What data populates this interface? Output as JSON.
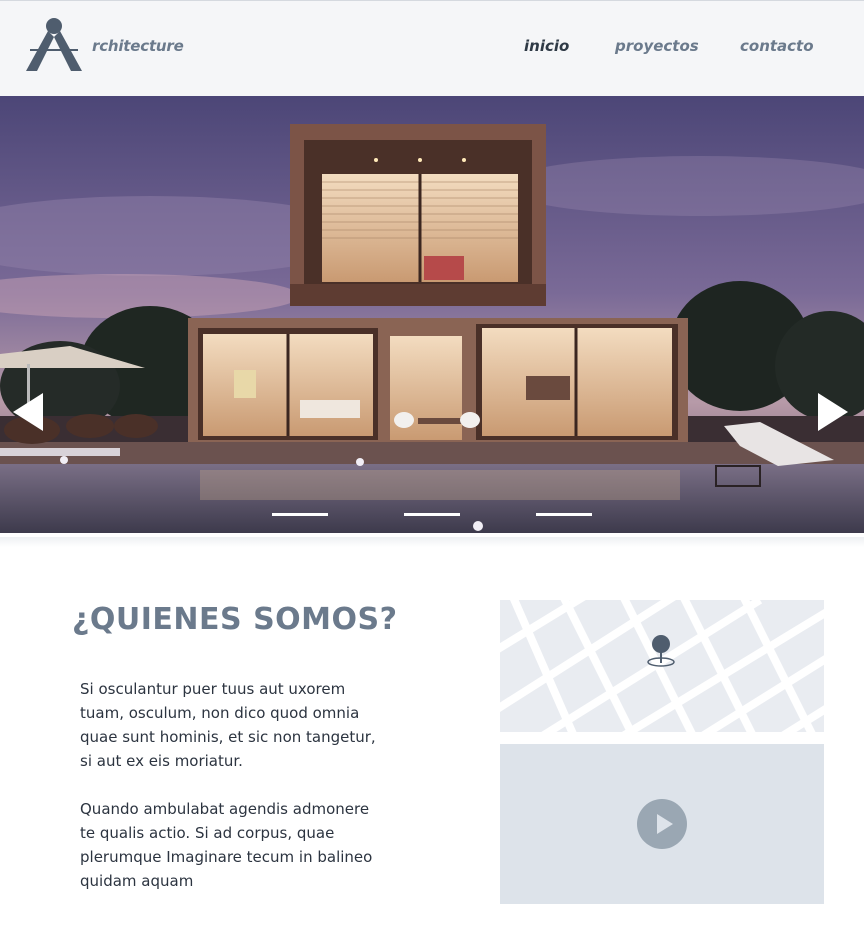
{
  "header": {
    "brand": "rchitecture",
    "nav": [
      {
        "label": "inicio",
        "active": true
      },
      {
        "label": "proyectos",
        "active": false
      },
      {
        "label": "contacto",
        "active": false
      }
    ]
  },
  "hero": {
    "slide_count": 3,
    "active_slide": 1
  },
  "about": {
    "title": "¿QUIENES SOMOS?",
    "paragraph_1": "Si osculantur puer tuus aut uxorem tuam, osculum, non dico quod omnia quae sunt hominis, et sic non tangetur, si aut ex eis moriatur.",
    "paragraph_2": "Quando ambulabat agendis admonere te qualis actio. Si ad corpus, quae plerumque Imaginare tecum in balineo quidam aquam"
  },
  "colors": {
    "header_bg": "#f5f6f8",
    "nav_text": "#6b7a8c",
    "nav_active": "#2f3a46",
    "logo": "#4f5d6e",
    "title": "#6b7a8c",
    "body_text": "#2c3440",
    "map_bg": "#e9ecf1",
    "video_bg": "#dde3ea",
    "play_button": "#9aa7b3"
  },
  "icons": {
    "logo": "compass-a-logo-icon",
    "prev": "arrow-left-icon",
    "next": "arrow-right-icon",
    "map_pin": "map-pin-icon",
    "play": "play-icon"
  }
}
